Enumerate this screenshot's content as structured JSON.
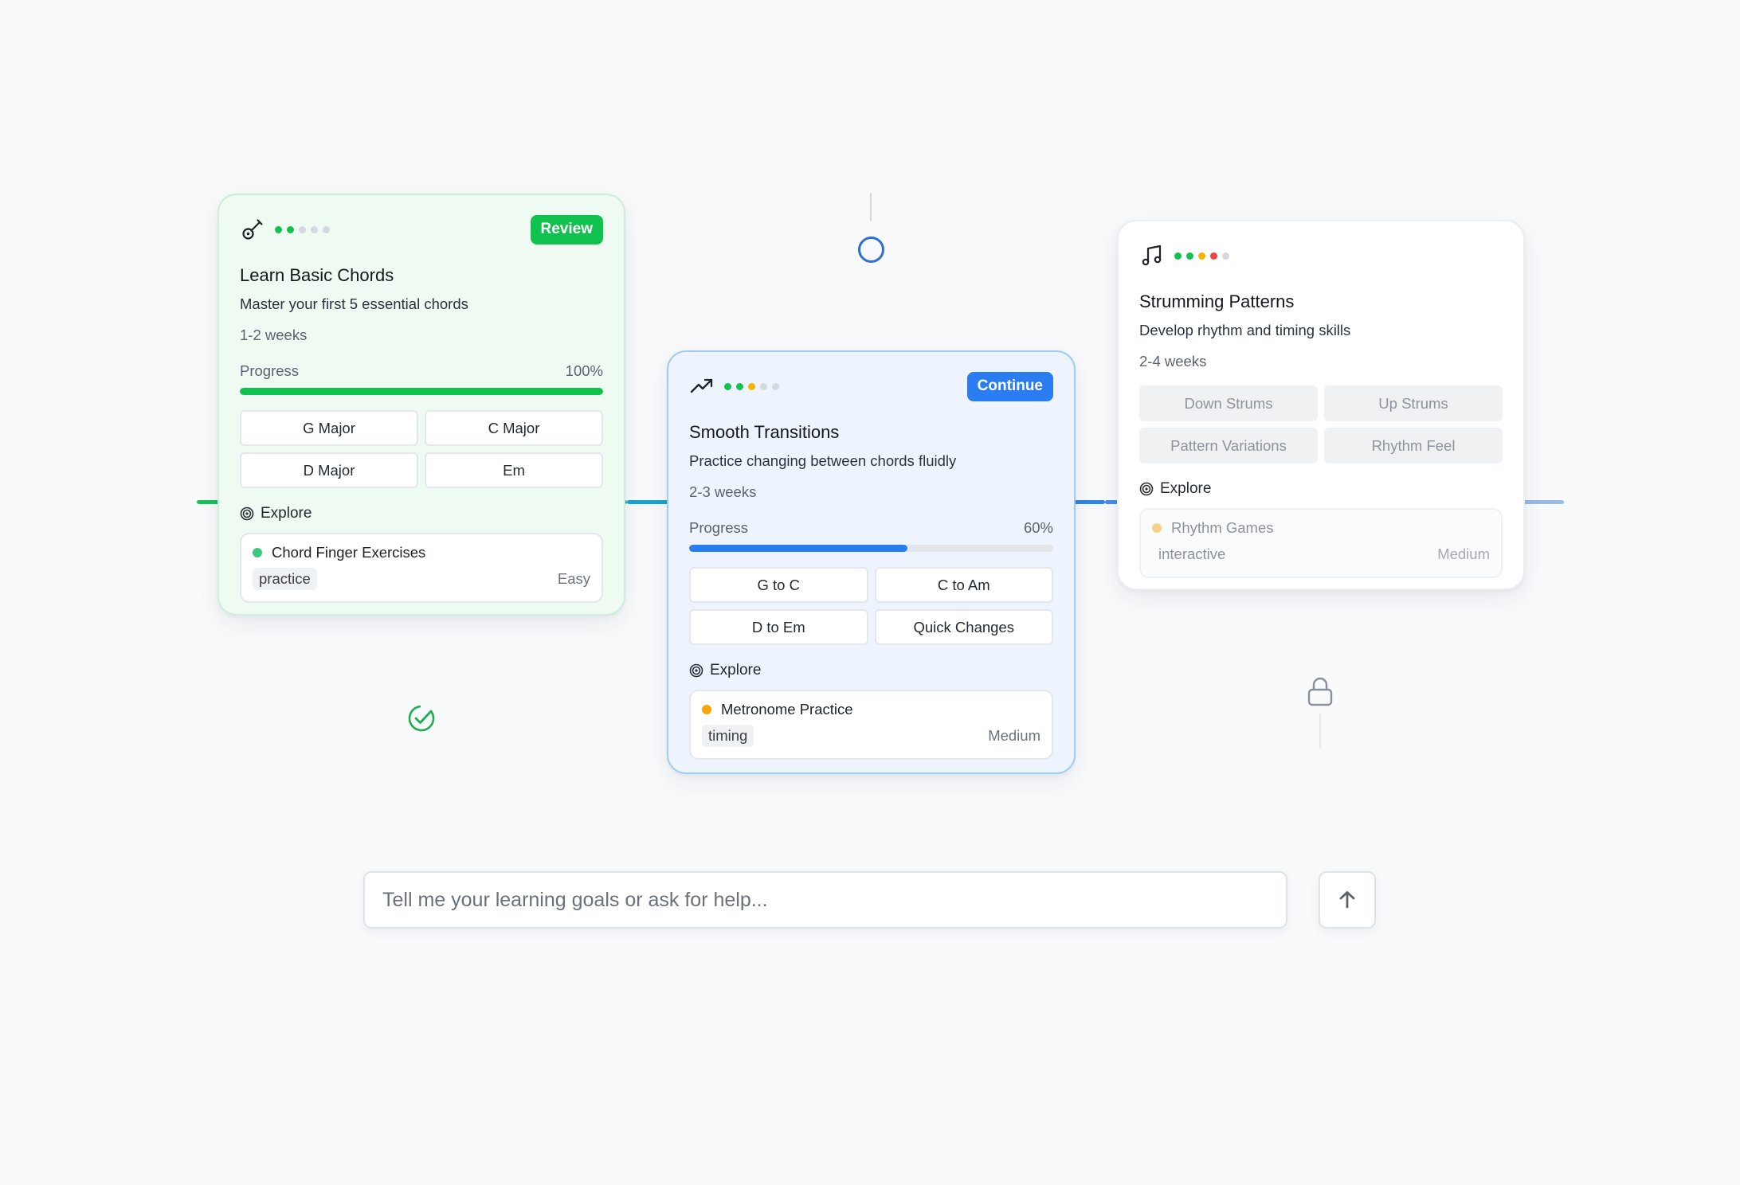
{
  "colors": {
    "green": "#12c24f",
    "blue": "#2a7df0",
    "yellow": "#f5b400",
    "red": "#ef4444",
    "gray": "#d5d9de"
  },
  "input": {
    "placeholder": "Tell me your learning goals or ask for help..."
  },
  "send_icon": "arrow-up-icon",
  "cards": [
    {
      "icon": "guitar-icon",
      "button": "Review",
      "title": "Learn Basic Chords",
      "subtitle": "Master your first 5 essential chords",
      "duration": "1-2 weeks",
      "progress_label": "Progress",
      "progress_value": "100%",
      "progress": 1.0,
      "chips": [
        "G Major",
        "C Major",
        "D Major",
        "Em"
      ],
      "explore_label": "Explore",
      "exercise": {
        "name": "Chord Finger Exercises",
        "tag": "practice",
        "level": "Easy"
      },
      "status_icon": "check-circle-icon"
    },
    {
      "icon": "trending-up-icon",
      "button": "Continue",
      "title": "Smooth Transitions",
      "subtitle": "Practice changing between chords fluidly",
      "duration": "2-3 weeks",
      "progress_label": "Progress",
      "progress_value": "60%",
      "progress": 0.6,
      "chips": [
        "G to C",
        "C to Am",
        "D to Em",
        "Quick Changes"
      ],
      "explore_label": "Explore",
      "exercise": {
        "name": "Metronome Practice",
        "tag": "timing",
        "level": "Medium"
      },
      "status_icon": "circle-ring-icon"
    },
    {
      "icon": "music-note-icon",
      "title": "Strumming Patterns",
      "subtitle": "Develop rhythm and timing skills",
      "duration": "2-4 weeks",
      "chips": [
        "Down Strums",
        "Up Strums",
        "Pattern Variations",
        "Rhythm Feel"
      ],
      "explore_label": "Explore",
      "exercise": {
        "name": "Rhythm Games",
        "tag": "interactive",
        "level": "Medium"
      },
      "status_icon": "lock-icon"
    }
  ]
}
